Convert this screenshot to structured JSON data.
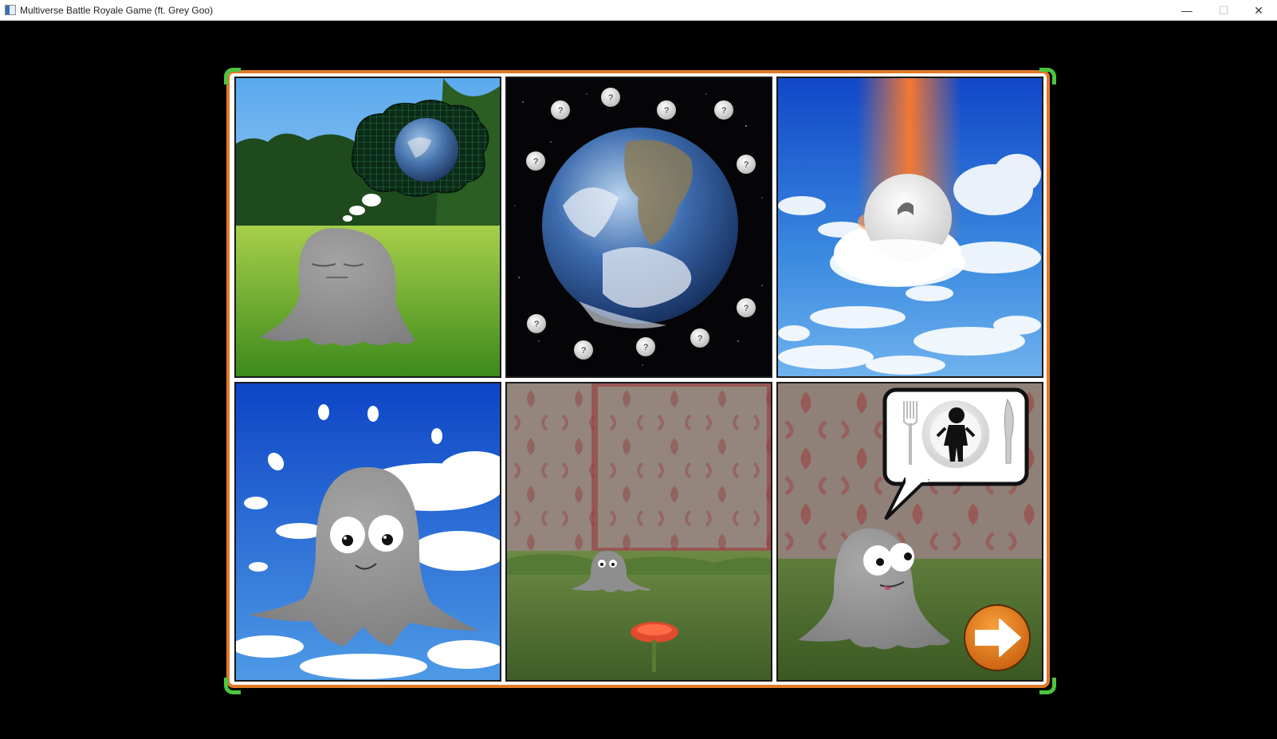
{
  "window": {
    "title": "Multiverse Battle Royale Game (ft. Grey Goo)",
    "controls": {
      "minimize": "—",
      "maximize": "☐",
      "close": "✕"
    }
  },
  "colors": {
    "frame_border": "#e07a28",
    "frame_corners": "#4cc63f",
    "goo": "#8f8f8f",
    "next_button": "#e6821e"
  },
  "comic": {
    "panels": [
      {
        "id": "panel-1",
        "scene": "grey goo dreaming of earth on a grassy meadow",
        "thought_icon": "earth-grid-icon"
      },
      {
        "id": "panel-2",
        "scene": "earth in space surrounded by question-mark goo balls",
        "orbiting_marker": "?"
      },
      {
        "id": "panel-3",
        "scene": "goo ball falling through clouds in an orange beam"
      },
      {
        "id": "panel-4",
        "scene": "goo grows big and happy in the sky"
      },
      {
        "id": "panel-5",
        "scene": "small goo in grass before a patterned rug with a red mushroom"
      },
      {
        "id": "panel-6",
        "scene": "goo hungry for a person on a plate",
        "speech_icon": "plate-person-icon"
      }
    ],
    "next_button": {
      "icon": "arrow-right-icon"
    }
  }
}
